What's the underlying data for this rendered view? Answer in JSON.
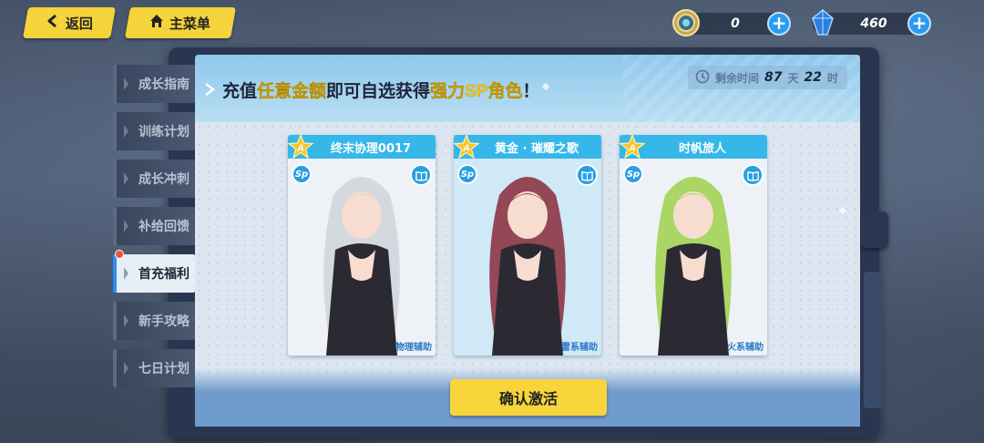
{
  "nav": {
    "back_label": "返回",
    "home_label": "主菜单"
  },
  "currency": {
    "coin_value": "0",
    "crystal_value": "460",
    "plus": "+"
  },
  "sidebar": {
    "items": [
      {
        "label": "成长指南"
      },
      {
        "label": "训练计划"
      },
      {
        "label": "成长冲刺"
      },
      {
        "label": "补给回馈"
      },
      {
        "label": "首充福利",
        "active": true,
        "notification": true
      },
      {
        "label": "新手攻略"
      },
      {
        "label": "七日计划"
      }
    ]
  },
  "header": {
    "promo_part1": "充值",
    "promo_highlight1": "任意金额",
    "promo_part2": "即可自选获得",
    "promo_highlight2": "强力SP角色",
    "promo_end": "！",
    "timer_label": "剩余时间",
    "timer_days": "87",
    "timer_day_unit": "天",
    "timer_hours": "22",
    "timer_hour_unit": "时"
  },
  "cards": [
    {
      "rank": "A",
      "name": "终末协理0017",
      "sp": "Sp",
      "role": "物理辅助",
      "portrait_bg": "#eef2f7",
      "hair": "#cfd3da"
    },
    {
      "rank": "A",
      "name": "黄金 · 璀耀之歌",
      "sp": "Sp",
      "role": "雷系辅助",
      "portrait_bg": "#cfe9f6",
      "hair": "#8a2a3a"
    },
    {
      "rank": "A",
      "name": "时帆旅人",
      "sp": "Sp",
      "role": "火系辅助",
      "portrait_bg": "#eef2f7",
      "hair": "#9cd14a"
    }
  ],
  "confirm_label": "确认激活",
  "colors": {
    "accent_yellow": "#f5d33a",
    "accent_blue": "#35b7e9",
    "highlight_text": "#f3c31c"
  }
}
